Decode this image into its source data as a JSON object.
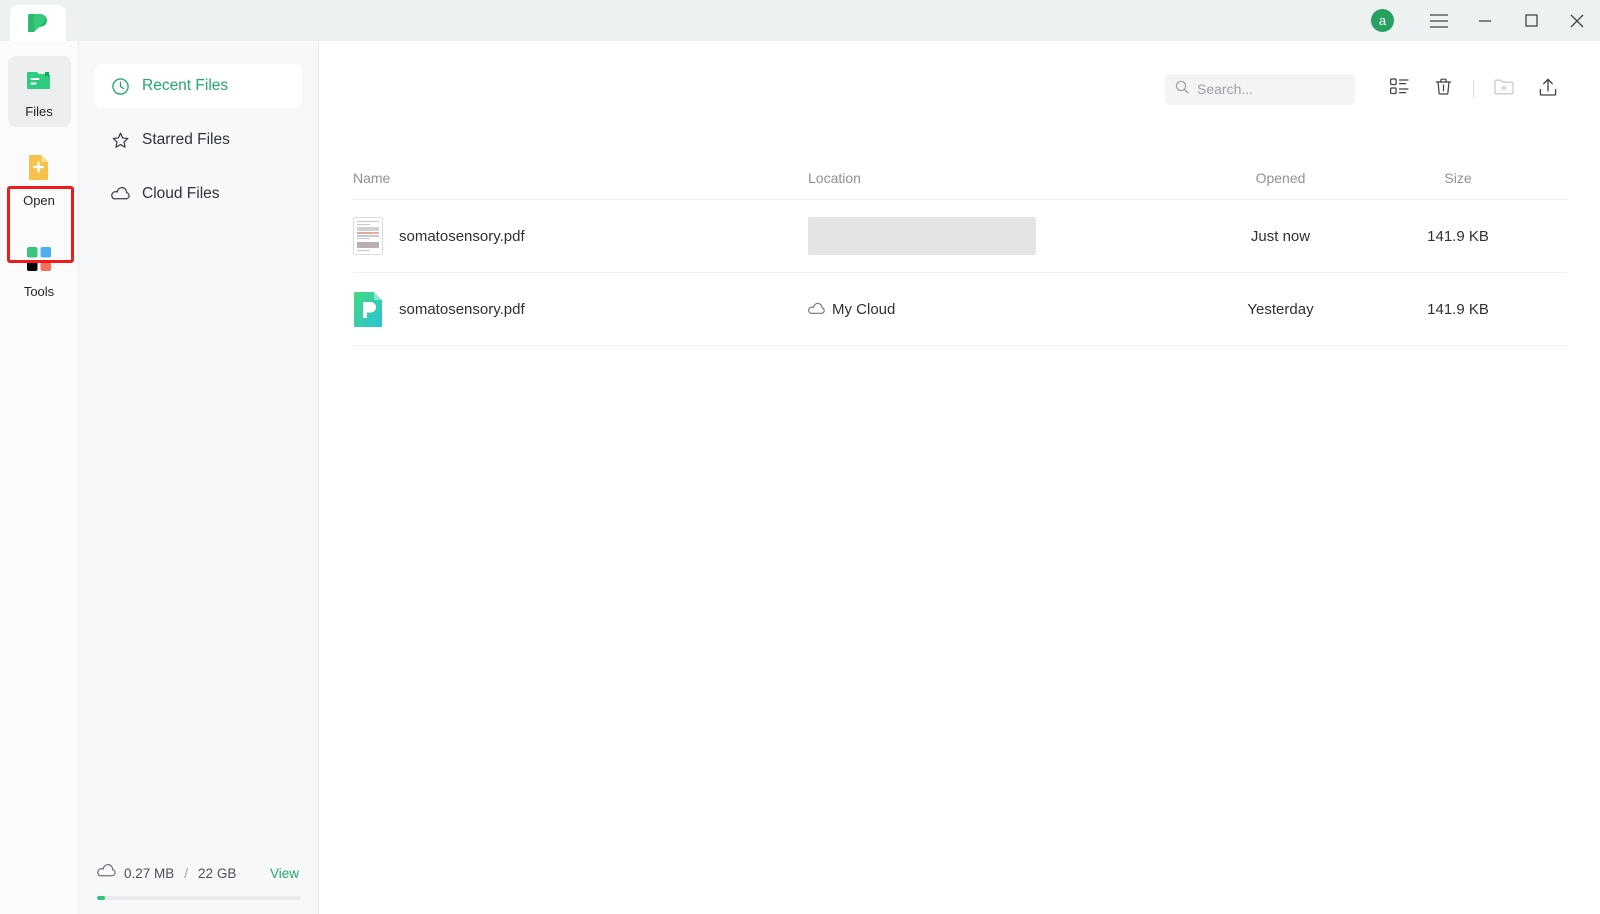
{
  "titlebar": {
    "app_logo_icon": "leaf-logo-icon",
    "new_tab_icon": "plus-icon",
    "avatar_letter": "a",
    "avatar_color": "#25a162",
    "menu_icon": "hamburger-menu-icon",
    "minimize_icon": "minimize-icon",
    "maximize_icon": "maximize-icon",
    "close_icon": "close-icon"
  },
  "rail": {
    "items": [
      {
        "label": "Files",
        "icon": "files-icon",
        "active": true
      },
      {
        "label": "Open",
        "icon": "open-document-plus-icon",
        "active": false,
        "highlighted": true
      },
      {
        "label": "Tools",
        "icon": "tools-grid-icon",
        "active": false
      }
    ],
    "highlight_color": "#ee1c1c"
  },
  "nav": {
    "items": [
      {
        "label": "Recent Files",
        "icon": "clock-icon",
        "active": true
      },
      {
        "label": "Starred Files",
        "icon": "star-icon",
        "active": false
      },
      {
        "label": "Cloud Files",
        "icon": "cloud-icon",
        "active": false
      }
    ],
    "accent_color": "#22a96d",
    "storage": {
      "icon": "cloud-icon",
      "used": "0.27 MB",
      "separator": "/",
      "total": "22 GB",
      "view_label": "View",
      "progress_percent": 4
    }
  },
  "toolbar": {
    "search_placeholder": "Search...",
    "search_value": "",
    "search_icon": "search-icon",
    "list_view_icon": "list-view-icon",
    "trash_icon": "trash-icon",
    "new_folder_icon": "new-folder-icon",
    "upload_icon": "upload-icon"
  },
  "table": {
    "columns": [
      "Name",
      "Location",
      "Opened",
      "Size"
    ],
    "rows": [
      {
        "name": "somatosensory.pdf",
        "icon": "document-thumbnail-icon",
        "location": "",
        "location_redacted": true,
        "location_icon": "",
        "opened": "Just now",
        "size": "141.9 KB"
      },
      {
        "name": "somatosensory.pdf",
        "icon": "pdf-app-icon",
        "location": "My Cloud",
        "location_redacted": false,
        "location_icon": "cloud-icon",
        "opened": "Yesterday",
        "size": "141.9 KB"
      }
    ]
  }
}
